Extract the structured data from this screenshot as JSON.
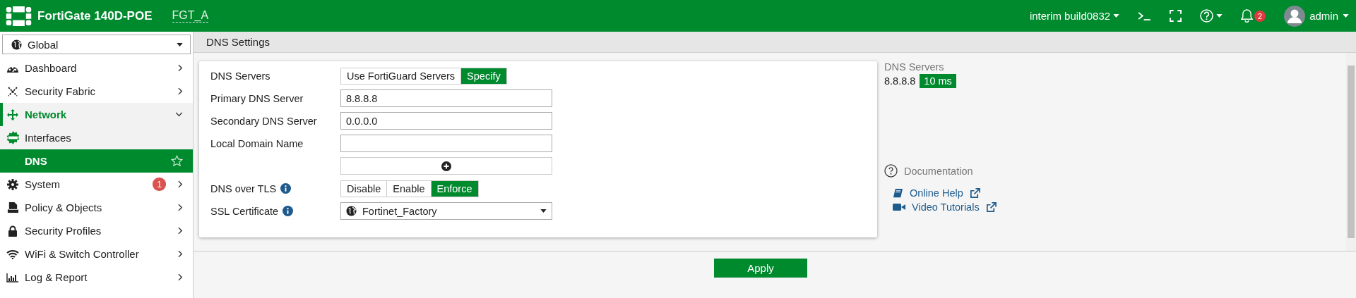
{
  "topbar": {
    "product": "FortiGate 140D-POE",
    "hostname": "FGT_A",
    "build": "interim build0832",
    "notification_count": "2",
    "user": "admin"
  },
  "sidebar": {
    "scope": "Global",
    "items": [
      {
        "label": "Dashboard",
        "expanded": false
      },
      {
        "label": "Security Fabric",
        "expanded": false
      },
      {
        "label": "Network",
        "expanded": true,
        "children": [
          {
            "label": "Interfaces",
            "selected": false
          },
          {
            "label": "DNS",
            "selected": true
          }
        ]
      },
      {
        "label": "System",
        "expanded": false,
        "badge": "1"
      },
      {
        "label": "Policy & Objects",
        "expanded": false
      },
      {
        "label": "Security Profiles",
        "expanded": false
      },
      {
        "label": "WiFi & Switch Controller",
        "expanded": false
      },
      {
        "label": "Log & Report",
        "expanded": false
      }
    ]
  },
  "page": {
    "title": "DNS Settings",
    "apply": "Apply"
  },
  "form": [
    {
      "kind": "segmented",
      "label": "DNS Servers",
      "info": false,
      "options": [
        {
          "label": "Use FortiGuard Servers",
          "selected": false
        },
        {
          "label": "Specify",
          "selected": true
        }
      ]
    },
    {
      "kind": "input",
      "label": "Primary DNS Server",
      "info": false,
      "value": "8.8.8.8"
    },
    {
      "kind": "input",
      "label": "Secondary DNS Server",
      "info": false,
      "value": "0.0.0.0"
    },
    {
      "kind": "input",
      "label": "Local Domain Name",
      "info": false
    },
    {
      "kind": "add"
    },
    {
      "kind": "segmented",
      "label": "DNS over TLS",
      "info": true,
      "options": [
        {
          "label": "Disable",
          "selected": false
        },
        {
          "label": "Enable",
          "selected": false
        },
        {
          "label": "Enforce",
          "selected": true
        }
      ]
    },
    {
      "kind": "select",
      "label": "SSL Certificate",
      "info": true,
      "value": "Fortinet_Factory"
    }
  ],
  "status": {
    "title": "DNS Servers",
    "server": "8.8.8.8",
    "latency": "10 ms"
  },
  "documentation": {
    "title": "Documentation",
    "links": [
      {
        "label": "Online Help"
      },
      {
        "label": "Video Tutorials"
      }
    ]
  }
}
